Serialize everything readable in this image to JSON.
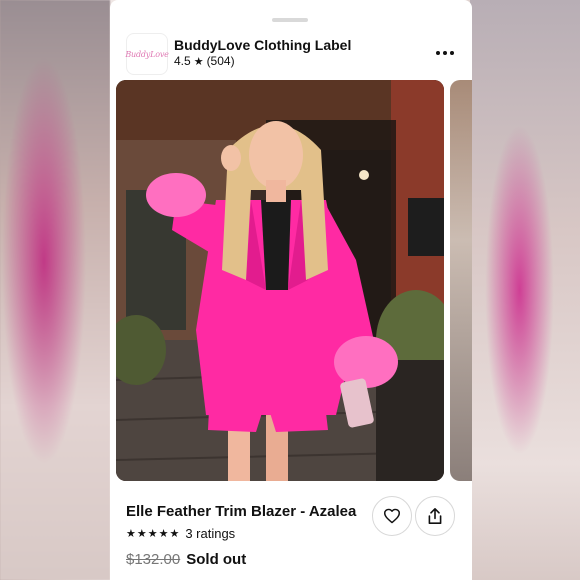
{
  "shop": {
    "logo_text": "BuddyLove",
    "name": "BuddyLove Clothing Label",
    "rating": "4.5",
    "review_count": "(504)"
  },
  "product": {
    "title": "Elle Feather Trim Blazer - Azalea",
    "stars": "★★★★★",
    "ratings_label": "3 ratings",
    "old_price": "$132.00",
    "status": "Sold out"
  },
  "icons": {
    "more": "more-horizontal-icon",
    "favorite": "heart-icon",
    "share": "share-icon",
    "star": "star-icon"
  },
  "colors": {
    "blazer_pink": "#ff2aa3",
    "text": "#111111",
    "muted": "#777777"
  }
}
